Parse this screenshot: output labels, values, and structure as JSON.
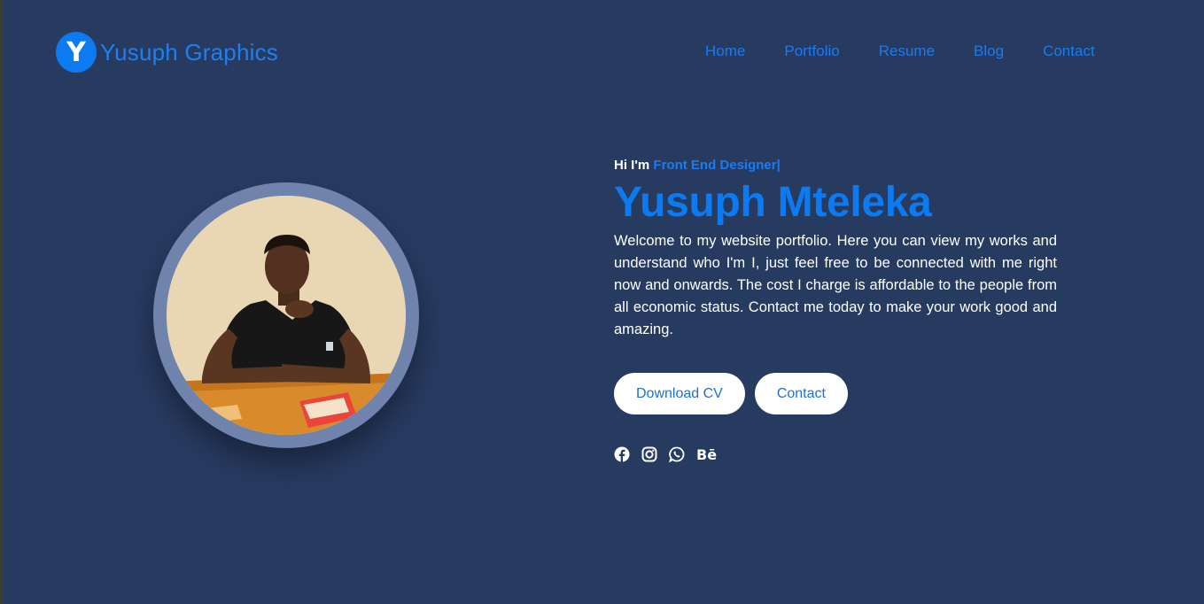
{
  "brand": {
    "initial": "Y",
    "name": "Yusuph Graphics"
  },
  "nav": [
    "Home",
    "Portfolio",
    "Resume",
    "Blog",
    "Contact"
  ],
  "hero": {
    "greeting_prefix": "Hi I'm ",
    "role": "Front End Designer|",
    "name": "Yusuph Mteleka",
    "bio": "Welcome to my website portfolio. Here you can view my works and understand who I'm I, just feel free to be connected with me right now and onwards. The cost I charge is affordable to the people from all economic status. Contact me today to make your work good and amazing.",
    "buttons": {
      "download": "Download CV",
      "contact": "Contact"
    },
    "socials": [
      "facebook-icon",
      "instagram-icon",
      "whatsapp-icon",
      "behance-icon"
    ],
    "behance_label": "Bē"
  },
  "colors": {
    "background": "#273A60",
    "accent": "#0c7bf2",
    "ring": "#6f83ad"
  }
}
